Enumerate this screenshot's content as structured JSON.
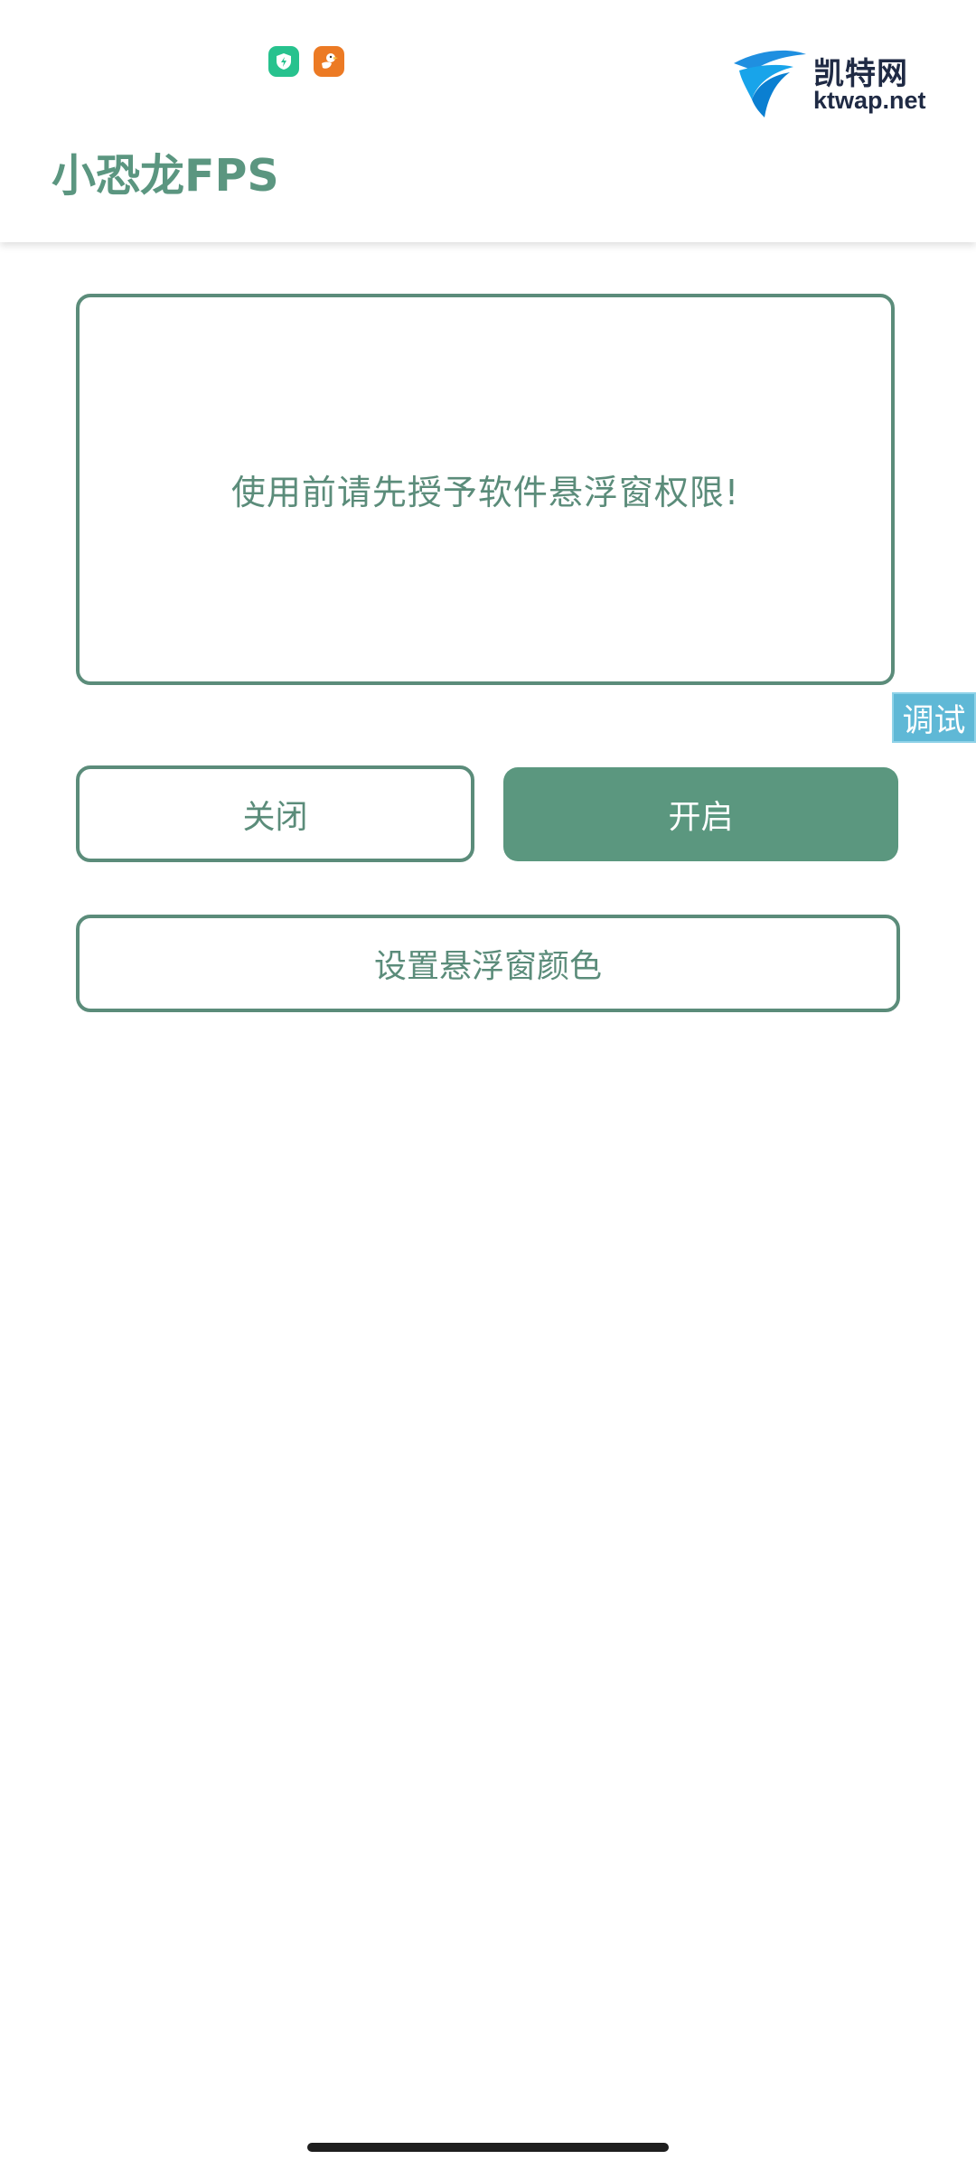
{
  "status_bar": {
    "icons": [
      "shield-app-icon",
      "goose-app-icon"
    ]
  },
  "watermark": {
    "brand_cn": "凯特网",
    "brand_en": "ktwap.net"
  },
  "app_bar": {
    "title": "小恐龙FPS"
  },
  "info_card": {
    "message": "使用前请先授予软件悬浮窗权限!"
  },
  "debug_tab": {
    "label": "调试"
  },
  "controls": {
    "close_label": "关闭",
    "open_label": "开启",
    "color_label": "设置悬浮窗颜色"
  },
  "colors": {
    "accent": "#5b977f",
    "accent_border": "#5b8c7a",
    "debug_tab": "#5fb8d6"
  }
}
